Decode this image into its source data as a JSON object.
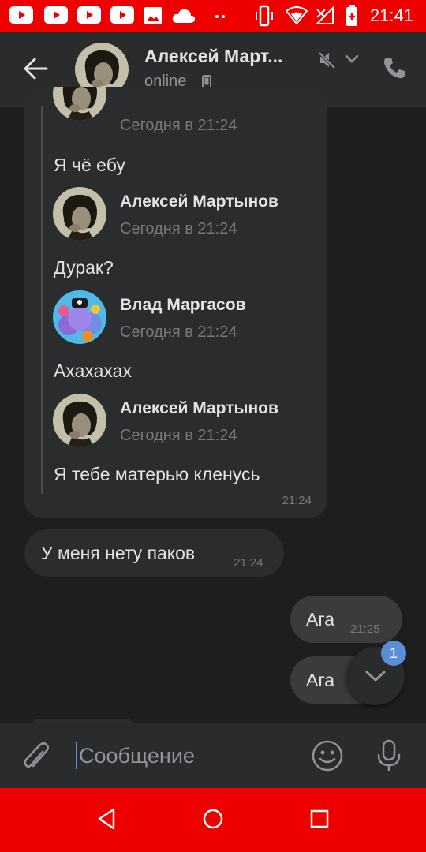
{
  "status_bar": {
    "time": "21:41"
  },
  "header": {
    "contact_name": "Алексей Март...",
    "status": "online"
  },
  "forwarded": {
    "items": [
      {
        "name": "",
        "date": "Сегодня в 21:24",
        "text": "Я чё ебу"
      },
      {
        "name": "Алексей Мартынов",
        "date": "Сегодня в 21:24",
        "text": "Дурак?"
      },
      {
        "name": "Влад Маргасов",
        "date": "Сегодня в 21:24",
        "text": "Ахахахах"
      },
      {
        "name": "Алексей Мартынов",
        "date": "Сегодня в 21:24",
        "text": "Я тебе матерью кленусь"
      }
    ],
    "time": "21:24"
  },
  "messages": [
    {
      "direction": "in",
      "text": "У меня нету паков",
      "time": "21:24"
    },
    {
      "direction": "out",
      "text": "Ага",
      "time": "21:25"
    },
    {
      "direction": "out",
      "text": "Ага",
      "time": ""
    }
  ],
  "scroll_down": {
    "unread_count": "1"
  },
  "composer": {
    "placeholder": "Сообщение"
  },
  "colors": {
    "system_bars": "#ee0000",
    "background": "#1e1e1f",
    "header": "#2a2b2d",
    "bubble": "#2b2c2e",
    "accent": "#5b8fd5"
  },
  "icons": {
    "back": "arrow-left-icon",
    "mute": "speaker-muted-icon",
    "call": "phone-icon",
    "attach": "paperclip-icon",
    "emoji": "smile-icon",
    "mic": "microphone-icon",
    "scroll": "chevron-down-icon"
  }
}
